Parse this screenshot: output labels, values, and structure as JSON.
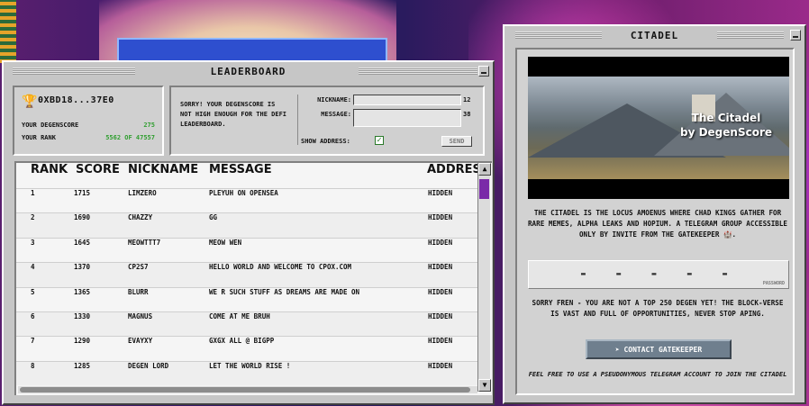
{
  "leaderboard": {
    "title": "LEADERBOARD",
    "user": {
      "address": "0XBD18...37E0",
      "degenscore_label": "YOUR DEGENSCORE",
      "degenscore_value": "275",
      "rank_label": "YOUR RANK",
      "rank_value": "5562 OF 47557"
    },
    "sorry_message": "SORRY! YOUR DEGENSCORE IS NOT HIGH ENOUGH FOR THE DEFI LEADERBOARD.",
    "form": {
      "nickname_label": "NICKNAME:",
      "nickname_value": "",
      "nickname_count": "12",
      "message_label": "MESSAGE:",
      "message_value": "",
      "message_count": "38",
      "show_address_label": "SHOW ADDRESS:",
      "show_address_checked": true,
      "send_label": "SEND"
    },
    "table": {
      "headers": {
        "rank": "RANK",
        "score": "SCORE",
        "nickname": "NICKNAME",
        "message": "MESSAGE",
        "address": "ADDRESS"
      },
      "rows": [
        {
          "rank": "1",
          "score": "1715",
          "nickname": "LIMZERO",
          "message": "PLEYUH ON OPENSEA",
          "address": "HIDDEN"
        },
        {
          "rank": "2",
          "score": "1690",
          "nickname": "CHAZZY",
          "message": "GG",
          "address": "HIDDEN"
        },
        {
          "rank": "3",
          "score": "1645",
          "nickname": "MEOWTTT7",
          "message": "MEOW WEN",
          "address": "HIDDEN"
        },
        {
          "rank": "4",
          "score": "1370",
          "nickname": "CP2S7",
          "message": "HELLO WORLD AND WELCOME TO CPOX.COM",
          "address": "HIDDEN"
        },
        {
          "rank": "5",
          "score": "1365",
          "nickname": "BLURR",
          "message": "WE R SUCH STUFF AS DREAMS ARE MADE ON",
          "address": "HIDDEN"
        },
        {
          "rank": "6",
          "score": "1330",
          "nickname": "MAGNUS",
          "message": "COME AT ME BRUH",
          "address": "HIDDEN"
        },
        {
          "rank": "7",
          "score": "1290",
          "nickname": "EVAYXY",
          "message": "GXGX ALL @ BIGPP",
          "address": "HIDDEN"
        },
        {
          "rank": "8",
          "score": "1285",
          "nickname": "DEGEN LORD",
          "message": "LET THE WORLD RISE !",
          "address": "HIDDEN"
        }
      ]
    }
  },
  "citadel": {
    "title": "CITADEL",
    "image_title_line1": "The Citadel",
    "image_title_line2": "by DegenScore",
    "description": "THE CITADEL IS THE LOCUS AMOENUS WHERE CHAD KINGS GATHER FOR RARE MEMES, ALPHA LEAKS AND HOPIUM. A TELEGRAM GROUP ACCESSIBLE ONLY BY INVITE FROM THE GATEKEEPER 🏰.",
    "password_mask": "- - - - -",
    "password_label": "PASSWORD",
    "sorry_message": "SORRY FREN - YOU ARE NOT A TOP 250 DEGEN YET! THE BLOCK-VERSE IS VAST AND FULL OF OPPORTUNITIES, NEVER STOP APING.",
    "contact_label": "CONTACT GATEKEEPER",
    "footer": "FEEL FREE TO USE A PSEUDONYMOUS TELEGRAM ACCOUNT TO JOIN THE CITADEL"
  },
  "colors": {
    "window_bg": "#c6c6c6",
    "score_green": "#2f9e2f",
    "scroll_thumb": "#7a2aa8",
    "button_bg": "#6f7f8e"
  },
  "icons": {
    "trophy": "trophy-icon",
    "telegram": "telegram-icon",
    "minimize": "minimize-icon"
  }
}
